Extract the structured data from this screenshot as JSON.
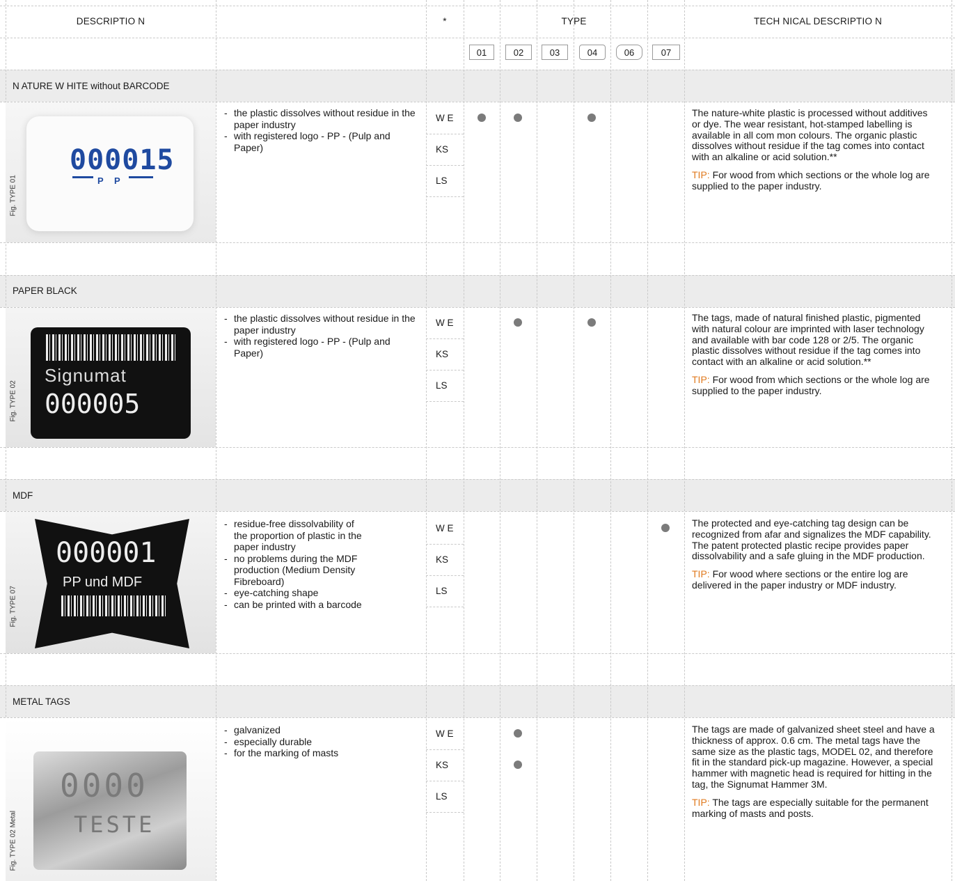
{
  "header": {
    "description": "DESCRIPTIO N",
    "star": "*",
    "type": "TYPE",
    "tech": "TECH NICAL DESCRIPTIO N",
    "type_codes": [
      "01",
      "02",
      "03",
      "04",
      "06",
      "07"
    ]
  },
  "sections": [
    {
      "category": "N ATURE W HITE without BARCODE",
      "fig": "Fig. TYPE 01",
      "photo_main": "000015",
      "photo_sub": "P P",
      "bullets": [
        "the plastic dissolves without residue in the paper industry",
        "with registered logo - PP - (Pulp and Paper)"
      ],
      "rows": [
        {
          "code": "W E",
          "dots": [
            1,
            1,
            0,
            1,
            0,
            0
          ]
        },
        {
          "code": "KS",
          "dots": [
            0,
            0,
            0,
            0,
            0,
            0
          ]
        },
        {
          "code": "LS",
          "dots": [
            0,
            0,
            0,
            0,
            0,
            0
          ]
        }
      ],
      "tech": "The nature-white plastic is processed without additives or dye. The wear resistant, hot-stamped labelling is available in all com mon colours. The organic plastic dissolves without residue if the tag comes into contact with an alkaline or acid solution.**",
      "tip_label": "TIP:",
      "tip": "For wood from which sections or the whole log are supplied to the paper industry."
    },
    {
      "category": "PAPER BLACK",
      "fig": "Fig. TYPE 02",
      "photo_main": "000005",
      "photo_sub": "Signumat",
      "bullets": [
        "the plastic dissolves without residue in the paper industry",
        "with registered logo - PP - (Pulp and Paper)"
      ],
      "rows": [
        {
          "code": "W E",
          "dots": [
            0,
            1,
            0,
            1,
            0,
            0
          ]
        },
        {
          "code": "KS",
          "dots": [
            0,
            0,
            0,
            0,
            0,
            0
          ]
        },
        {
          "code": "LS",
          "dots": [
            0,
            0,
            0,
            0,
            0,
            0
          ]
        }
      ],
      "tech": "The tags, made of natural finished plastic, pigmented with natural colour are imprinted with laser technology and available with bar code 128 or 2/5. The organic plastic dissolves without residue if the tag comes into contact with an alkaline or acid solution.**",
      "tip_label": "TIP:",
      "tip": "For wood from which sections or the whole log are supplied to the paper industry."
    },
    {
      "category": "MDF",
      "fig": "Fig. TYPE 07",
      "photo_main": "000001",
      "photo_sub": "PP und MDF",
      "bullets": [
        "residue-free dissolvability of the proportion of plastic in the paper industry",
        "no problems during the MDF production (Medium Density Fibreboard)",
        "eye-catching shape",
        "can be printed with a barcode"
      ],
      "rows": [
        {
          "code": "W E",
          "dots": [
            0,
            0,
            0,
            0,
            0,
            1
          ]
        },
        {
          "code": "KS",
          "dots": [
            0,
            0,
            0,
            0,
            0,
            0
          ]
        },
        {
          "code": "LS",
          "dots": [
            0,
            0,
            0,
            0,
            0,
            0
          ]
        }
      ],
      "tech": "The protected and eye-catching tag design can be recognized from afar and signalizes the MDF capability. The patent protected plastic recipe provides paper dissolvability and a safe gluing in the MDF production.",
      "tip_label": "TIP:",
      "tip": "For wood where sections or the entire log are delivered in the paper industry or MDF industry."
    },
    {
      "category": "METAL TAGS",
      "fig": "Fig. TYPE 02 Metal",
      "photo_main": "0000",
      "photo_sub": "TESTE",
      "bullets": [
        "galvanized",
        "especially durable",
        "for the marking of masts"
      ],
      "rows": [
        {
          "code": "W E",
          "dots": [
            0,
            1,
            0,
            0,
            0,
            0
          ]
        },
        {
          "code": "KS",
          "dots": [
            0,
            1,
            0,
            0,
            0,
            0
          ]
        },
        {
          "code": "LS",
          "dots": [
            0,
            0,
            0,
            0,
            0,
            0
          ]
        }
      ],
      "tech": "The tags are made of galvanized sheet steel and have a thickness of approx. 0.6 cm. The metal tags have the same size as the plastic tags, MODEL 02, and therefore fit in the standard pick-up magazine. However, a special hammer with magnetic head is required for hitting in the tag, the Signumat Hammer 3M.",
      "tip_label": "TIP:",
      "tip": "The tags are especially suitable for the permanent marking of masts and posts."
    }
  ]
}
